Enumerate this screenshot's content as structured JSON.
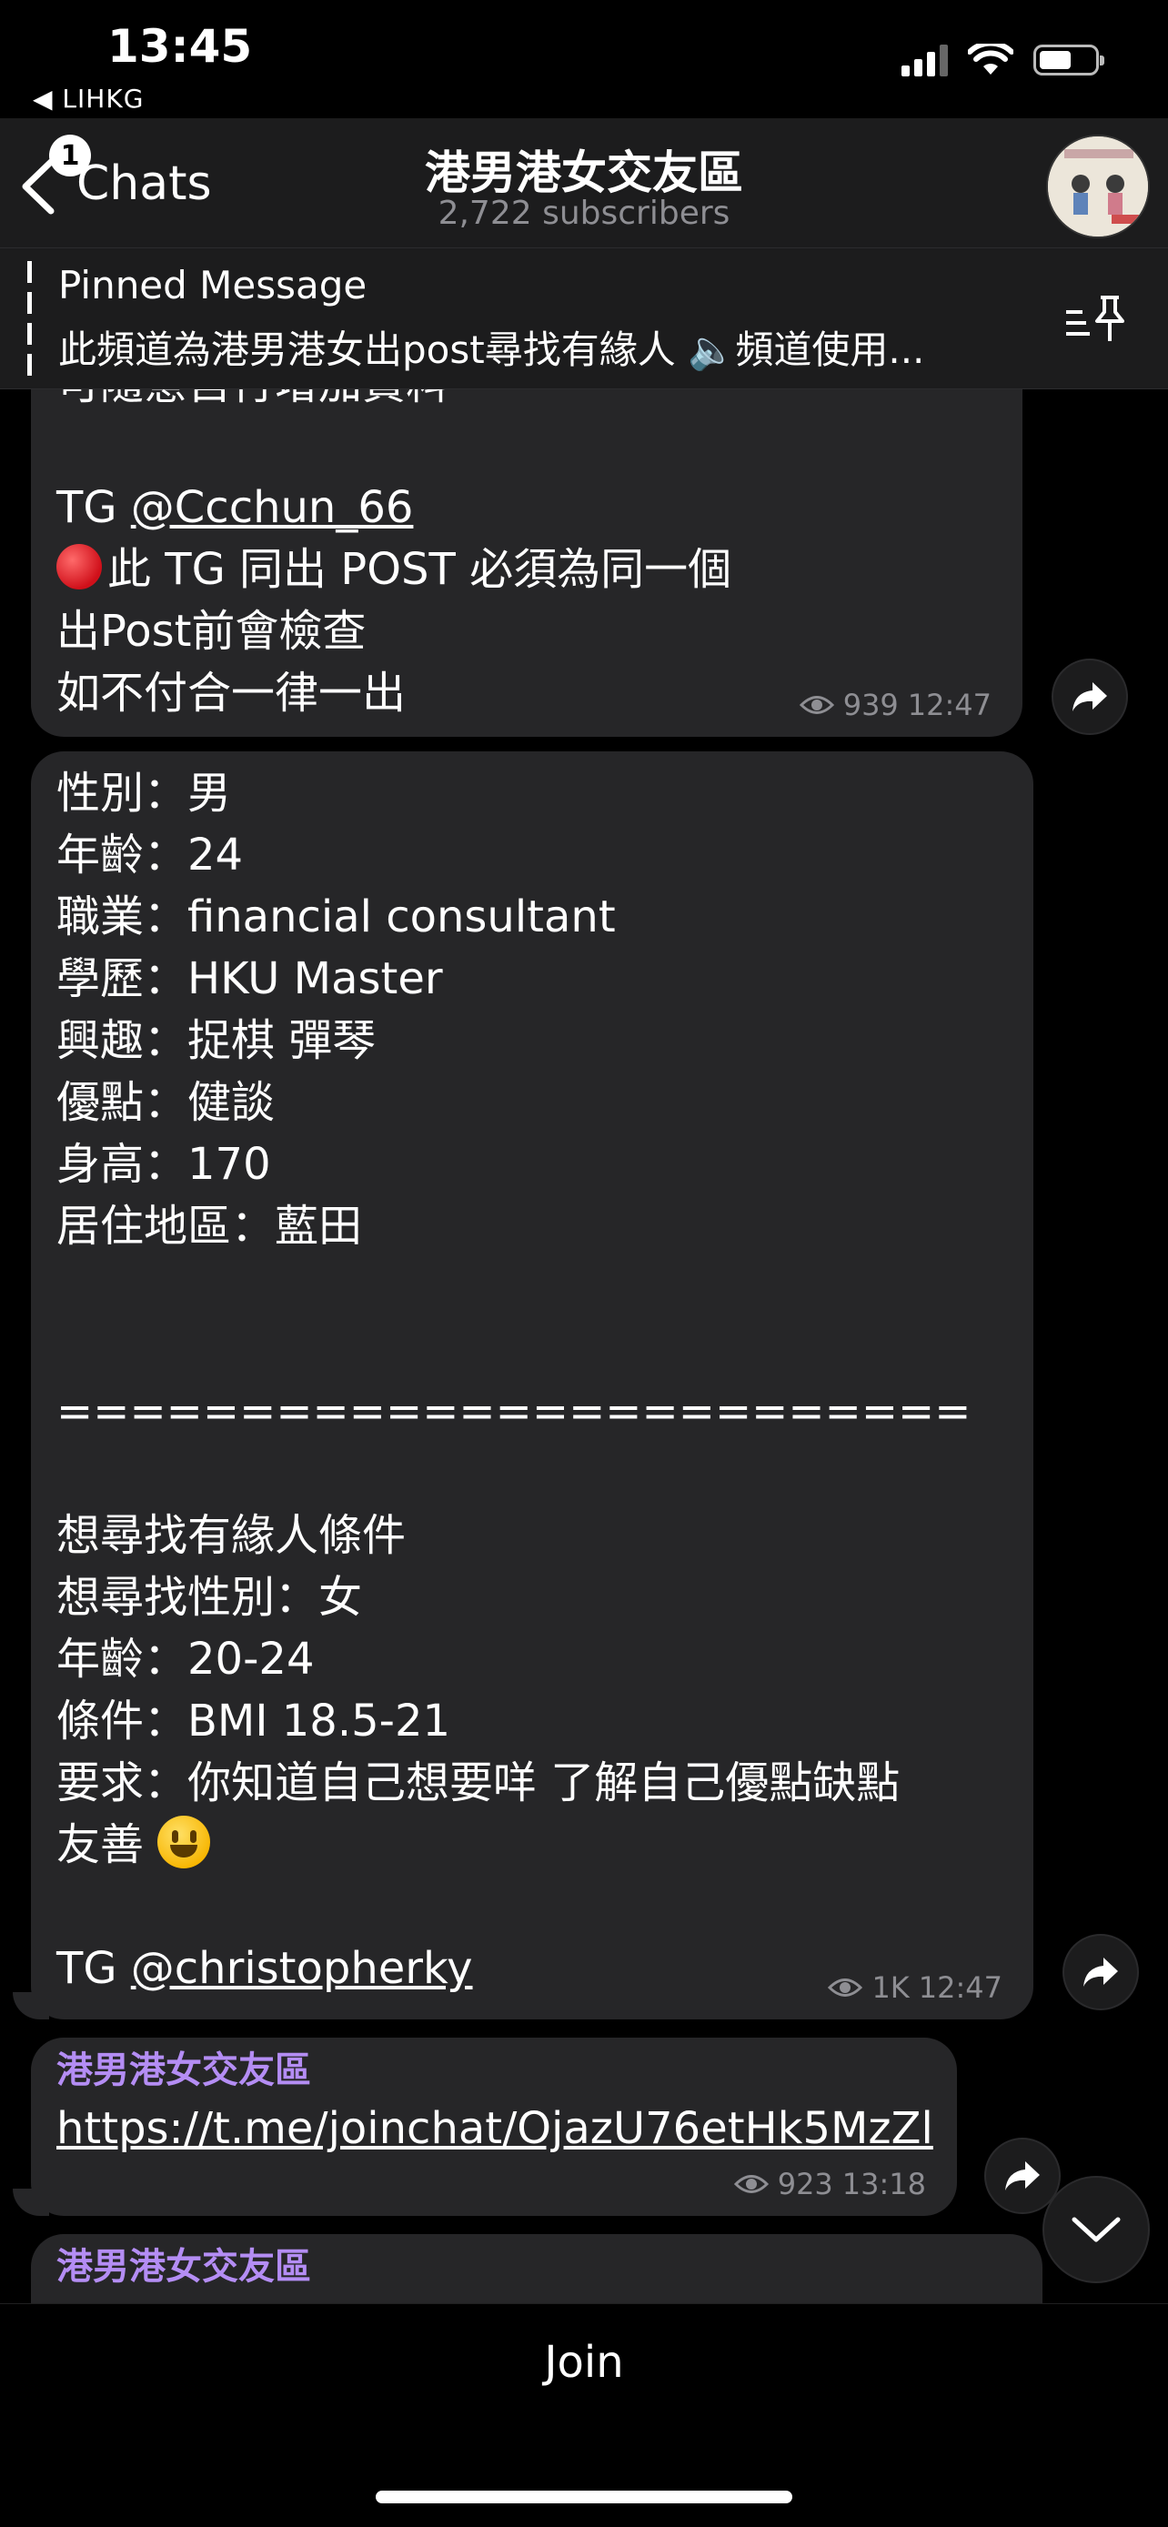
{
  "status_bar": {
    "time": "13:45",
    "back_app": "◀ LIHKG"
  },
  "header": {
    "back_label": "Chats",
    "unread_badge": "1",
    "title": "港男港女交友區",
    "subtitle": "2,722 subscribers"
  },
  "pinned": {
    "title": "Pinned Message",
    "text": "此頻道為港男港女出post尋找有緣人 🔈頻道使用..."
  },
  "messages": {
    "m1": {
      "top_partial": "可隨意自行增加資料",
      "tg_prefix": "TG ",
      "tg_handle": "@Ccchun_66",
      "note1": "此 TG 同出 POST 必須為同一個",
      "note2": "出Post前會檢查",
      "note3": "如不付合一律一出",
      "views": "939",
      "time": "12:47"
    },
    "m2": {
      "lines": [
        "性別：男",
        "年齡：24",
        "職業：financial consultant",
        "學歷：HKU Master",
        "興趣：捉棋 彈琴",
        "優點：健談",
        "身高：170",
        "居住地區：藍田"
      ],
      "divider": "=========================",
      "want_lines": [
        "想尋找有緣人條件",
        "想尋找性別：女",
        "年齡：20-24",
        "條件：BMI 18.5-21",
        "要求：你知道自己想要咩 了解自己優點缺點"
      ],
      "friendly": "友善",
      "tg_prefix": "TG ",
      "tg_handle": "@christopherky",
      "views": "1K",
      "time": "12:47"
    },
    "m3": {
      "sender": "港男港女交友區",
      "link": "https://t.me/joinchat/OjazU76etHk5MzZl",
      "views": "923",
      "time": "13:18"
    },
    "m4": {
      "sender": "港男港女交友區"
    }
  },
  "footer": {
    "join_label": "Join"
  }
}
